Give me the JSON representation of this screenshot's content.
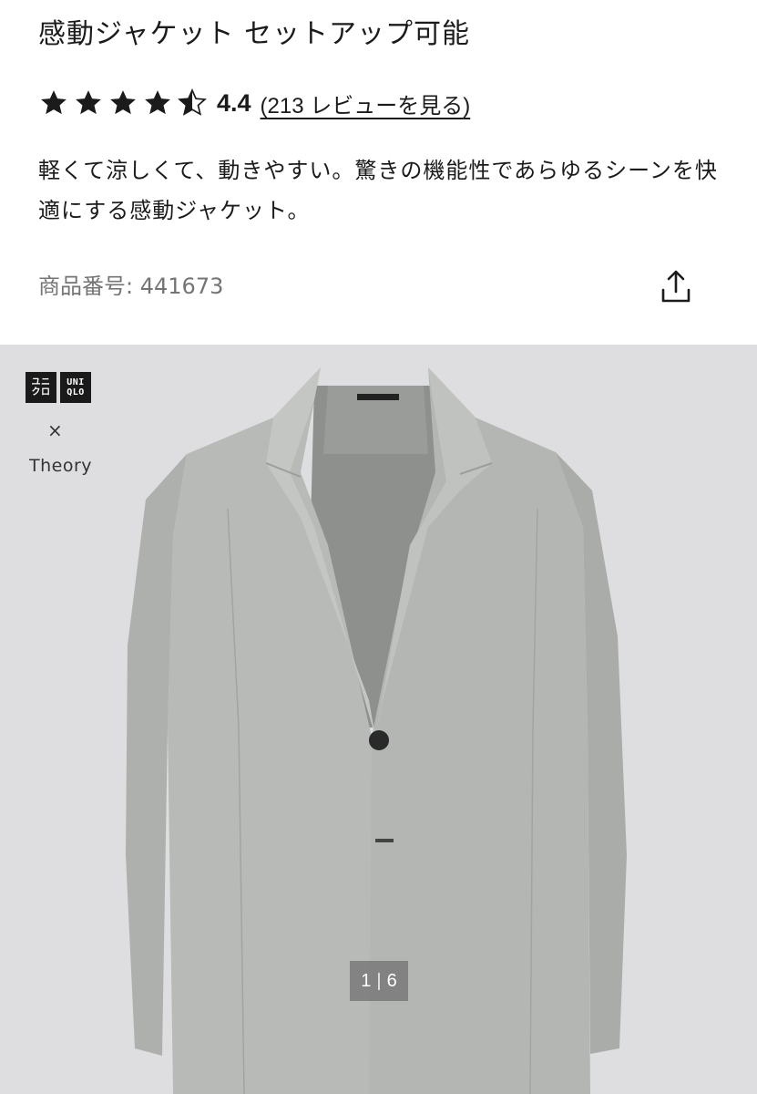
{
  "product": {
    "title": "感動ジャケット セットアップ可能",
    "rating": {
      "stars": 4.5,
      "value": "4.4",
      "open_paren": "(",
      "review_link": "213 レビューを見る",
      "close_paren": ")"
    },
    "description": "軽くて涼しくて、動きやすい。驚きの機能性であらゆるシーンを快適にする感動ジャケット。",
    "number_label": "商品番号:",
    "number_value": "441673"
  },
  "share": {
    "icon": "share-icon"
  },
  "gallery": {
    "logo": {
      "tile1_top": "ユニ",
      "tile1_bottom": "クロ",
      "tile2_top": "UNI",
      "tile2_bottom": "QLO"
    },
    "collab_symbol": "×",
    "collab_name": "Theory",
    "pager": {
      "current": "1",
      "separator": "|",
      "total": "6"
    }
  },
  "colors": {
    "text": "#1b1b1b",
    "muted": "#747474",
    "gallery_bg": "#dedee0",
    "jacket": "#b8bab8"
  }
}
